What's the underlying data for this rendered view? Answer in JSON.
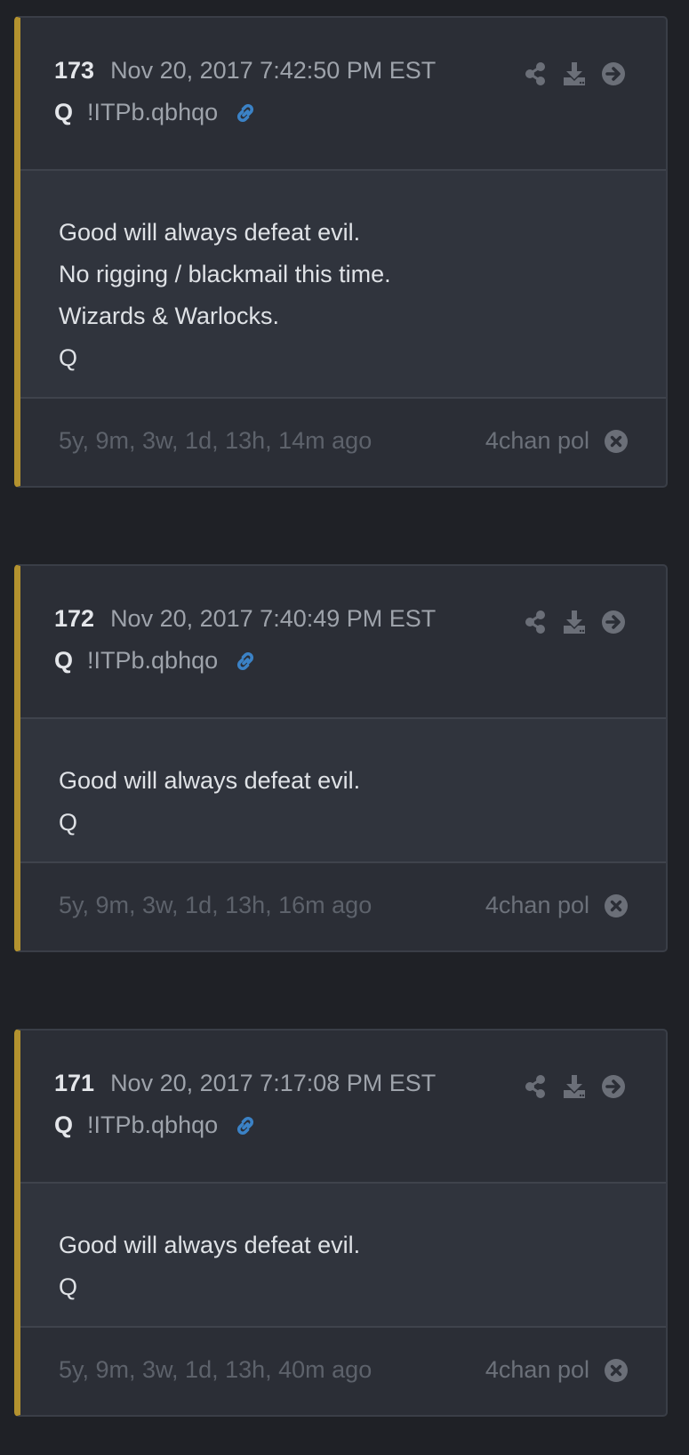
{
  "colors": {
    "background": "#1f2126",
    "card": "#2b2e36",
    "body": "#30343d",
    "accent_border": "#b3922f",
    "link_icon": "#3b82c6",
    "icon_gray": "#6b6f78"
  },
  "posts": [
    {
      "number": "173",
      "date": "Nov 20, 2017 7:42:50 PM EST",
      "author": "Q",
      "tripcode": "!ITPb.qbhqo",
      "lines": [
        "Good will always defeat evil.",
        "No rigging / blackmail this time.",
        "Wizards & Warlocks.",
        "Q"
      ],
      "ago": "5y, 9m, 3w, 1d, 13h, 14m ago",
      "source": "4chan pol",
      "icons": [
        "share-icon",
        "download-icon",
        "arrow-right-icon",
        "link-icon",
        "close-icon"
      ]
    },
    {
      "number": "172",
      "date": "Nov 20, 2017 7:40:49 PM EST",
      "author": "Q",
      "tripcode": "!ITPb.qbhqo",
      "lines": [
        "Good will always defeat evil.",
        "Q"
      ],
      "ago": "5y, 9m, 3w, 1d, 13h, 16m ago",
      "source": "4chan pol",
      "icons": [
        "share-icon",
        "download-icon",
        "arrow-right-icon",
        "link-icon",
        "close-icon"
      ]
    },
    {
      "number": "171",
      "date": "Nov 20, 2017 7:17:08 PM EST",
      "author": "Q",
      "tripcode": "!ITPb.qbhqo",
      "lines": [
        "Good will always defeat evil.",
        "Q"
      ],
      "ago": "5y, 9m, 3w, 1d, 13h, 40m ago",
      "source": "4chan pol",
      "icons": [
        "share-icon",
        "download-icon",
        "arrow-right-icon",
        "link-icon",
        "close-icon"
      ]
    }
  ]
}
